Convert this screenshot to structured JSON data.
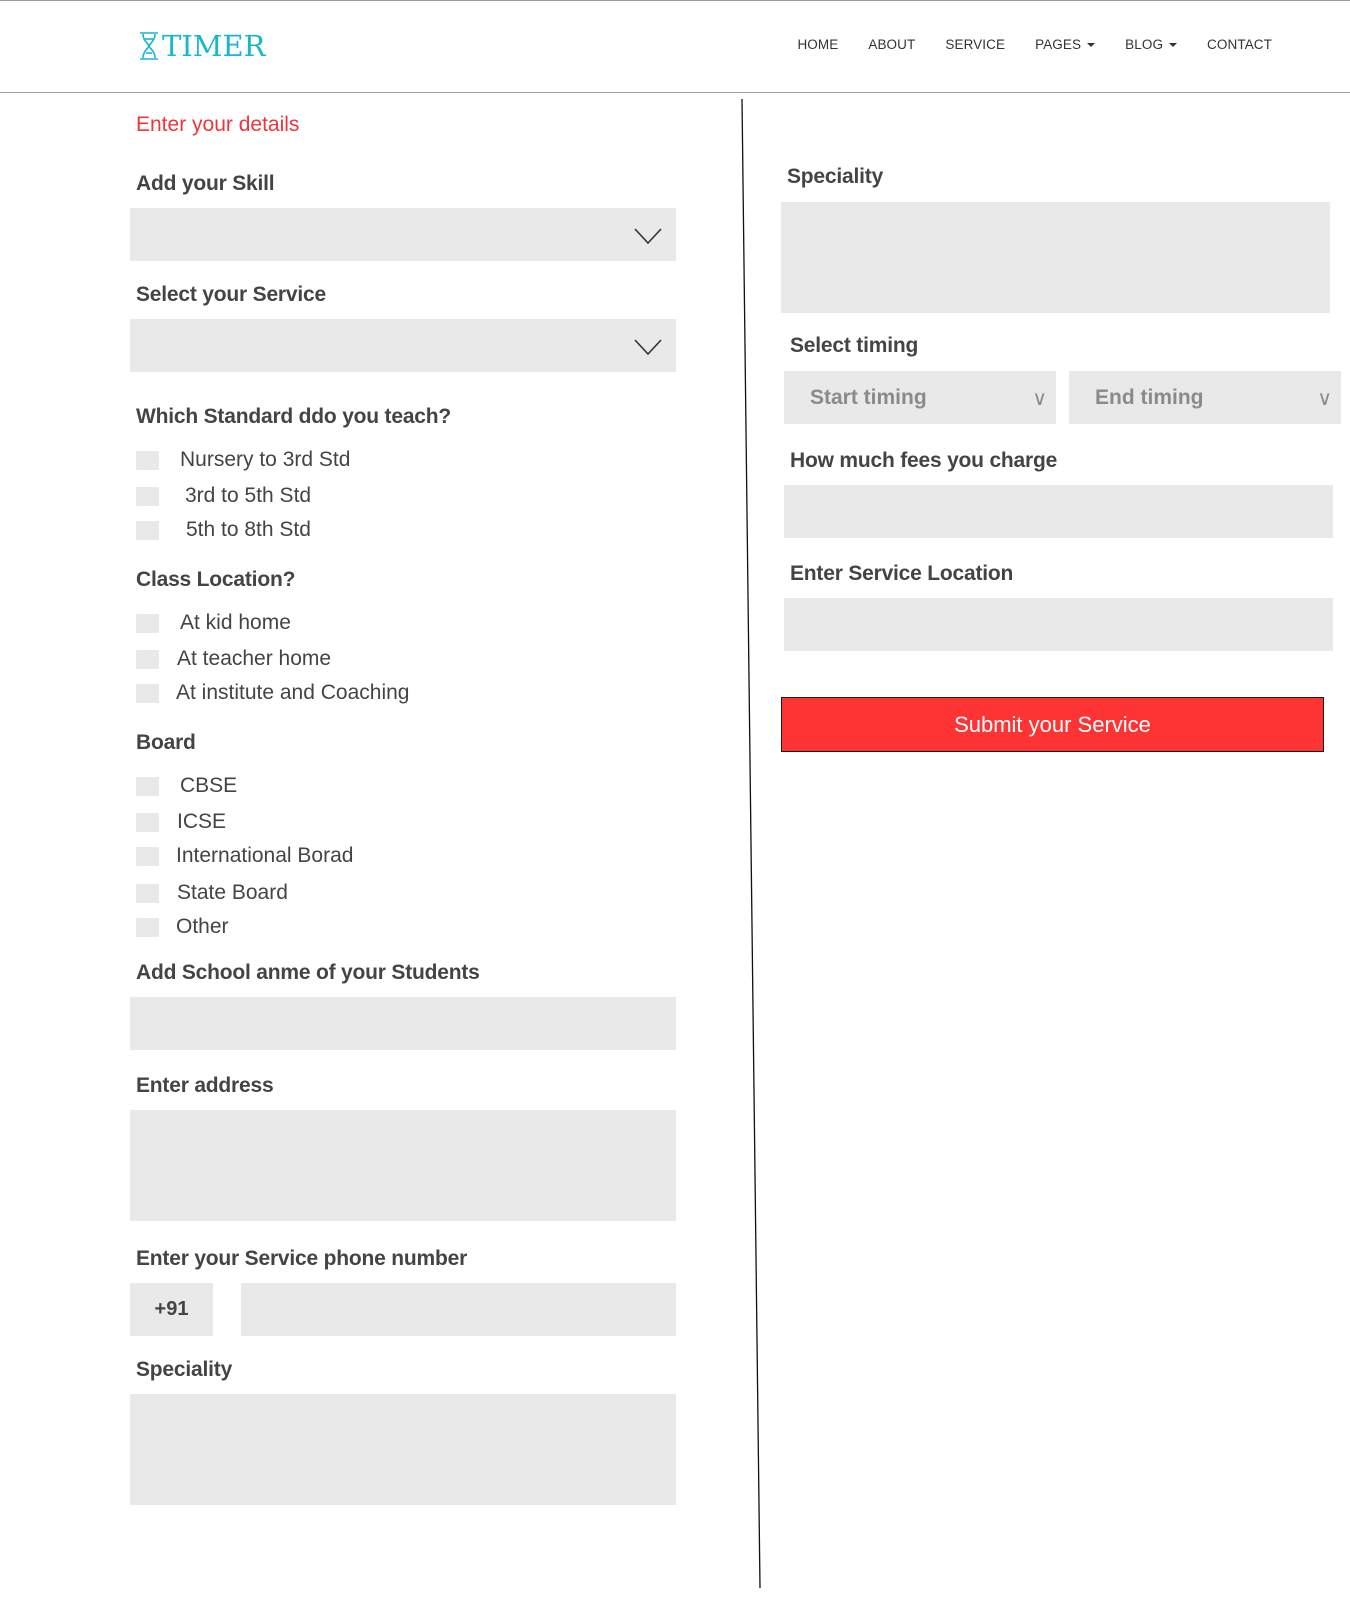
{
  "header": {
    "logo_text": "TIMER",
    "nav": [
      {
        "label": "HOME",
        "dropdown": false
      },
      {
        "label": "ABOUT",
        "dropdown": false
      },
      {
        "label": "SERVICE",
        "dropdown": false
      },
      {
        "label": "PAGES",
        "dropdown": true
      },
      {
        "label": "BLOG",
        "dropdown": true
      },
      {
        "label": "CONTACT",
        "dropdown": false
      }
    ]
  },
  "form": {
    "heading": "Enter your details",
    "skill_label": "Add your Skill",
    "skill_value": "",
    "service_label": "Select your Service",
    "service_value": "",
    "standard_label": "Which Standard ddo you teach?",
    "standards": [
      "Nursery to 3rd Std",
      "3rd to 5th Std",
      "5th to 8th Std"
    ],
    "location_label": "Class Location?",
    "locations": [
      "At kid home",
      "At teacher home",
      "At institute and Coaching"
    ],
    "board_label": "Board",
    "boards": [
      "CBSE",
      "ICSE",
      "International Borad",
      "State Board",
      "Other"
    ],
    "school_label": "Add School anme of your Students",
    "school_value": "",
    "address_label": "Enter address",
    "address_value": "",
    "phone_label": "Enter your Service phone number",
    "phone_prefix": "+91",
    "phone_value": "",
    "speciality_left_label": "Speciality",
    "speciality_left_value": "",
    "speciality_right_label": "Speciality",
    "speciality_right_value": "",
    "timing_label": "Select timing",
    "start_timing": "Start timing",
    "end_timing": "End timing",
    "fees_label": "How much fees you charge",
    "fees_value": "",
    "service_location_label": "Enter Service Location",
    "service_location_value": "",
    "submit_label": "Submit your Service"
  },
  "colors": {
    "accent_red": "#fe3334",
    "heading_red": "#f0343a",
    "logo_teal": "#1ab6cf",
    "field_gray": "#e9e9e9"
  }
}
